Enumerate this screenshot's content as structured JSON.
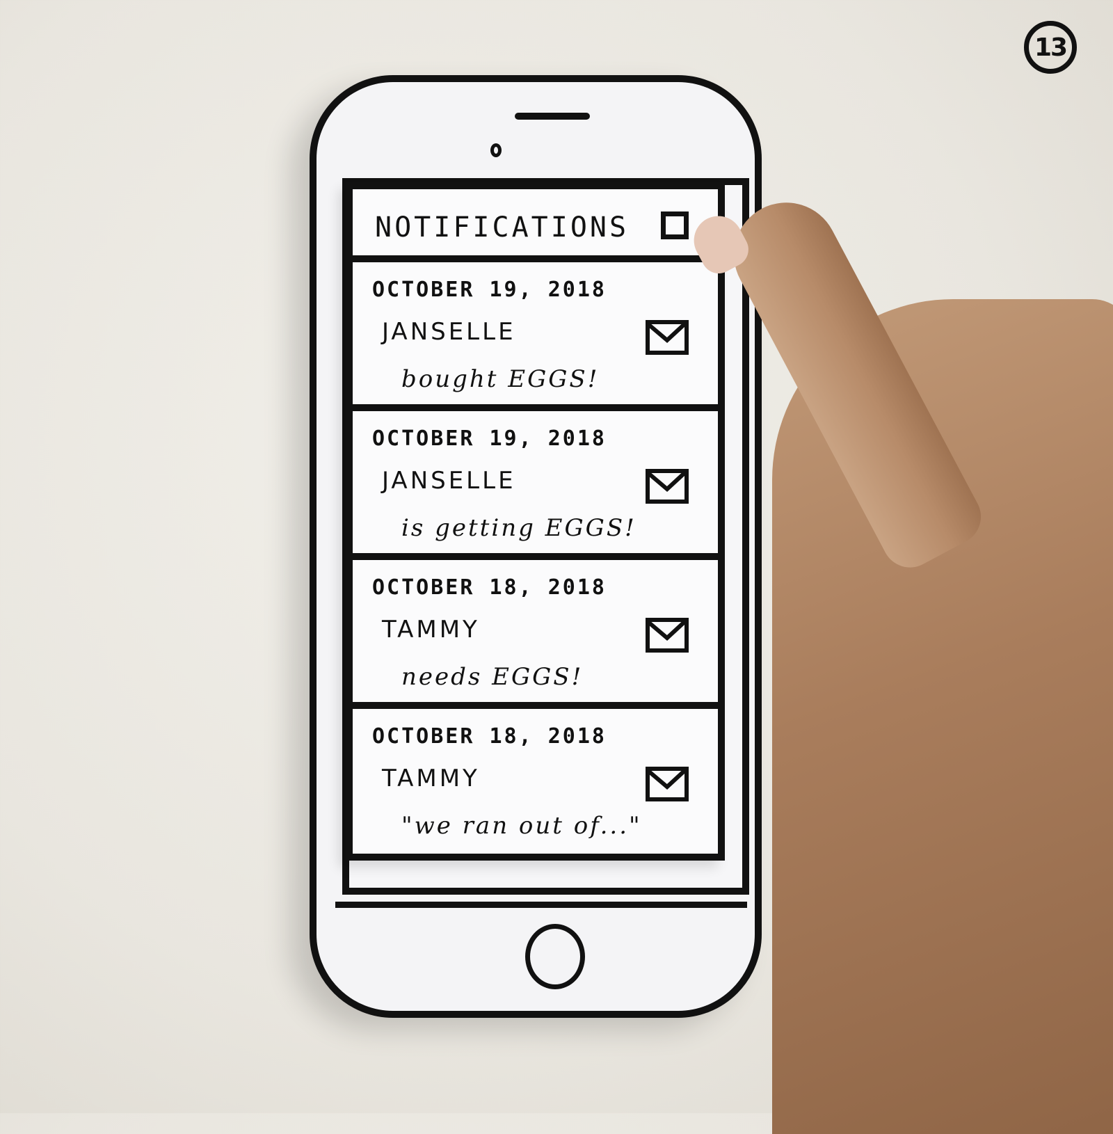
{
  "page_badge": "13",
  "screen": {
    "title": "NOTIFICATIONS",
    "close_icon": "close-box-icon"
  },
  "notifications": [
    {
      "date": "OCTOBER 19, 2018",
      "name": "JANSELLE",
      "message": "bought EGGS!",
      "icon": "envelope-icon"
    },
    {
      "date": "OCTOBER 19, 2018",
      "name": "JANSELLE",
      "message": "is getting EGGS!",
      "icon": "envelope-icon"
    },
    {
      "date": "OCTOBER 18, 2018",
      "name": "TAMMY",
      "message": "needs EGGS!",
      "icon": "envelope-icon"
    },
    {
      "date": "OCTOBER 18, 2018",
      "name": "TAMMY",
      "message": "\"we ran out of...\"",
      "icon": "envelope-icon"
    }
  ]
}
